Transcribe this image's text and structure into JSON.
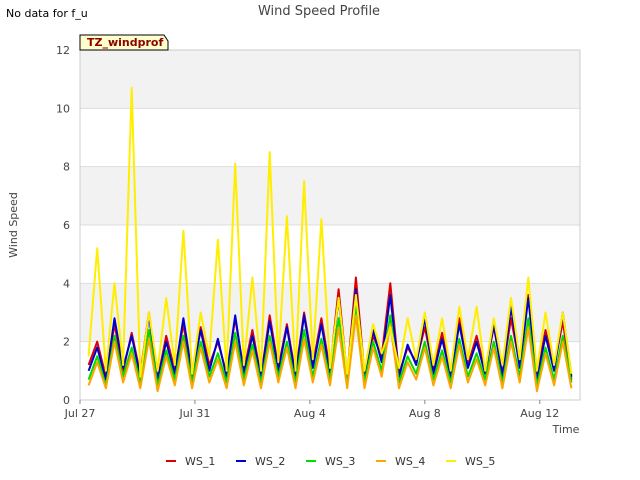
{
  "notice": "No data for f_u",
  "chart_data": {
    "type": "line",
    "title": "Wind Speed Profile",
    "xlabel": "Time",
    "ylabel": "Wind Speed",
    "ylim": [
      0,
      12
    ],
    "yticks": [
      0,
      2,
      4,
      6,
      8,
      10,
      12
    ],
    "xlim_days": [
      0,
      17.4
    ],
    "xticks": [
      {
        "label": "Jul 27",
        "day": 0
      },
      {
        "label": "Jul 31",
        "day": 4
      },
      {
        "label": "Aug 4",
        "day": 8
      },
      {
        "label": "Aug 8",
        "day": 12
      },
      {
        "label": "Aug 12",
        "day": 16
      }
    ],
    "annotation": "TZ_windprof",
    "grid": true,
    "legend_position": "bottom",
    "series": [
      {
        "name": "WS_1",
        "color": "#dd0000"
      },
      {
        "name": "WS_2",
        "color": "#0000cc"
      },
      {
        "name": "WS_3",
        "color": "#00dd00"
      },
      {
        "name": "WS_4",
        "color": "#ffa500"
      },
      {
        "name": "WS_5",
        "color": "#ffee00"
      }
    ],
    "x_days": [
      0.3,
      0.6,
      0.9,
      1.2,
      1.5,
      1.8,
      2.1,
      2.4,
      2.7,
      3.0,
      3.3,
      3.6,
      3.9,
      4.2,
      4.5,
      4.8,
      5.1,
      5.4,
      5.7,
      6.0,
      6.3,
      6.6,
      6.9,
      7.2,
      7.5,
      7.8,
      8.1,
      8.4,
      8.7,
      9.0,
      9.3,
      9.6,
      9.9,
      10.2,
      10.5,
      10.8,
      11.1,
      11.4,
      11.7,
      12.0,
      12.3,
      12.6,
      12.9,
      13.2,
      13.5,
      13.8,
      14.1,
      14.4,
      14.7,
      15.0,
      15.3,
      15.6,
      15.9,
      16.2,
      16.5,
      16.8,
      17.1
    ],
    "ws1": [
      1.2,
      2.0,
      0.8,
      2.6,
      1.0,
      2.3,
      0.9,
      3.0,
      0.7,
      2.2,
      1.0,
      2.6,
      0.8,
      2.5,
      1.2,
      2.0,
      0.9,
      2.8,
      1.0,
      2.4,
      0.8,
      2.9,
      1.1,
      2.6,
      0.9,
      3.0,
      1.2,
      2.8,
      1.0,
      3.8,
      0.8,
      4.2,
      0.9,
      2.2,
      1.5,
      4.0,
      0.9,
      1.8,
      1.3,
      2.5,
      1.0,
      2.3,
      0.8,
      2.8,
      1.2,
      2.2,
      1.0,
      2.5,
      0.9,
      2.8,
      1.2,
      3.6,
      0.8,
      2.4,
      1.1,
      2.7,
      0.7
    ],
    "ws2": [
      1.0,
      1.8,
      0.7,
      2.8,
      1.1,
      2.2,
      0.8,
      2.9,
      0.7,
      2.0,
      0.9,
      2.8,
      0.9,
      2.4,
      1.0,
      2.1,
      0.8,
      2.9,
      0.9,
      2.2,
      0.8,
      2.7,
      1.0,
      2.5,
      0.8,
      2.9,
      1.1,
      2.6,
      0.9,
      3.5,
      0.7,
      3.8,
      0.8,
      2.4,
      1.3,
      3.6,
      0.8,
      1.9,
      1.2,
      2.8,
      0.9,
      2.1,
      0.8,
      2.6,
      1.1,
      2.0,
      0.9,
      2.6,
      0.8,
      3.2,
      1.1,
      3.5,
      0.7,
      2.2,
      1.0,
      3.0,
      0.8
    ],
    "ws3": [
      0.7,
      1.5,
      0.5,
      2.2,
      0.8,
      1.8,
      0.6,
      2.4,
      0.5,
      1.7,
      0.7,
      2.2,
      0.6,
      2.0,
      0.8,
      1.6,
      0.6,
      2.3,
      0.7,
      1.9,
      0.6,
      2.2,
      0.8,
      2.0,
      0.6,
      2.4,
      0.8,
      2.1,
      0.7,
      2.8,
      0.6,
      3.2,
      0.6,
      2.0,
      1.0,
      2.9,
      0.6,
      1.5,
      0.9,
      2.0,
      0.7,
      1.7,
      0.6,
      2.1,
      0.8,
      1.6,
      0.7,
      2.0,
      0.6,
      2.2,
      0.8,
      2.8,
      0.5,
      1.8,
      0.7,
      2.2,
      0.6
    ],
    "ws4": [
      0.5,
      1.3,
      0.4,
      2.0,
      0.6,
      1.6,
      0.4,
      2.1,
      0.3,
      1.5,
      0.5,
      2.0,
      0.4,
      1.8,
      0.6,
      1.4,
      0.4,
      2.0,
      0.5,
      1.7,
      0.4,
      2.0,
      0.6,
      1.8,
      0.4,
      2.1,
      0.6,
      1.9,
      0.5,
      2.5,
      0.4,
      2.9,
      0.4,
      1.8,
      0.8,
      2.6,
      0.4,
      1.3,
      0.7,
      1.8,
      0.5,
      1.5,
      0.4,
      1.9,
      0.6,
      1.4,
      0.5,
      1.8,
      0.4,
      2.0,
      0.6,
      2.5,
      0.3,
      1.6,
      0.5,
      2.0,
      0.4
    ],
    "ws5": [
      1.5,
      5.2,
      1.0,
      4.0,
      1.2,
      10.7,
      0.8,
      3.0,
      1.0,
      3.5,
      1.2,
      5.8,
      0.9,
      3.0,
      1.5,
      5.5,
      1.0,
      8.1,
      1.2,
      4.2,
      1.0,
      8.5,
      1.3,
      6.3,
      1.0,
      7.5,
      1.4,
      6.2,
      1.1,
      3.5,
      0.9,
      3.6,
      1.0,
      2.6,
      1.6,
      2.5,
      1.1,
      2.8,
      1.4,
      3.0,
      1.2,
      2.8,
      1.0,
      3.2,
      1.4,
      3.2,
      1.0,
      2.8,
      1.2,
      3.5,
      1.4,
      4.2,
      1.0,
      3.0,
      1.2,
      3.0,
      0.9
    ]
  }
}
